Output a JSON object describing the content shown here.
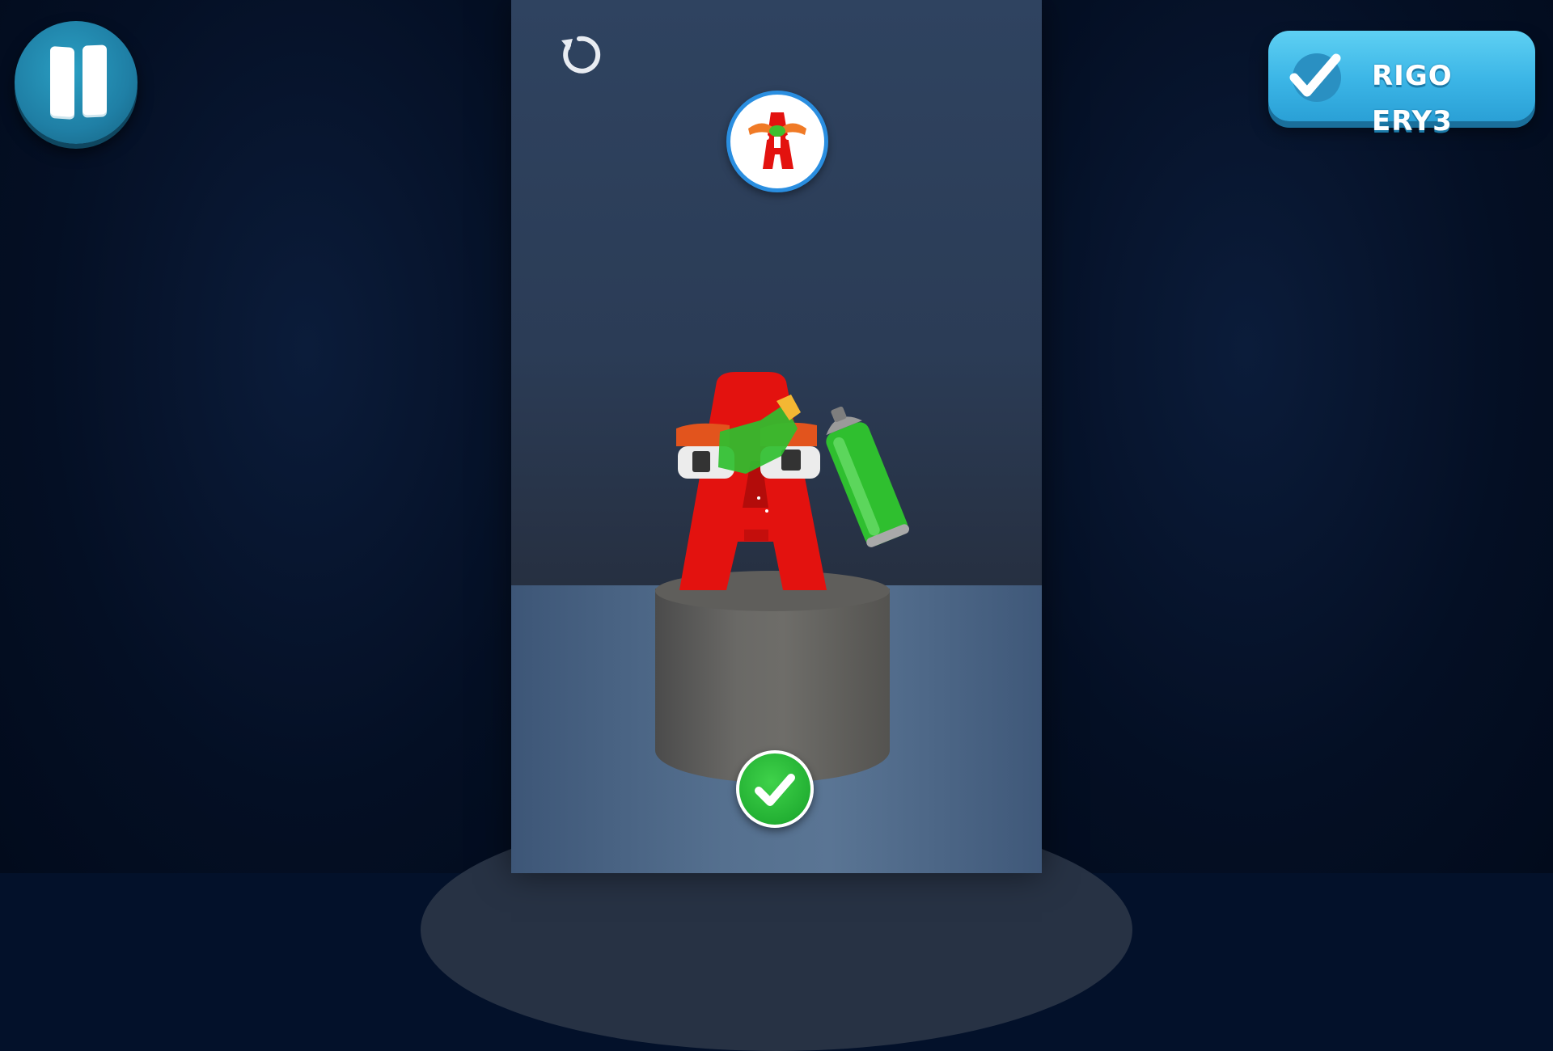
{
  "hud": {
    "pause_icon": "pause-icon",
    "restart_icon": "restart-icon",
    "complete_button": {
      "label": "RIGO ERY3",
      "icon": "checkmark-icon"
    },
    "confirm_icon": "checkmark-icon"
  },
  "target": {
    "letter": "A",
    "icon": "letter-a-character-icon"
  },
  "character": {
    "letter": "A",
    "body_color": "#e3120f"
  },
  "tool": {
    "icon": "spray-can-icon",
    "paint_color": "#2fbf2f"
  },
  "colors": {
    "accent_blue": "#3bb5e6",
    "pause_blue": "#1f7fa5",
    "confirm_green": "#23b033",
    "letter_red": "#e3120f",
    "spray_green": "#2fbf2f",
    "background": "#03112a"
  }
}
